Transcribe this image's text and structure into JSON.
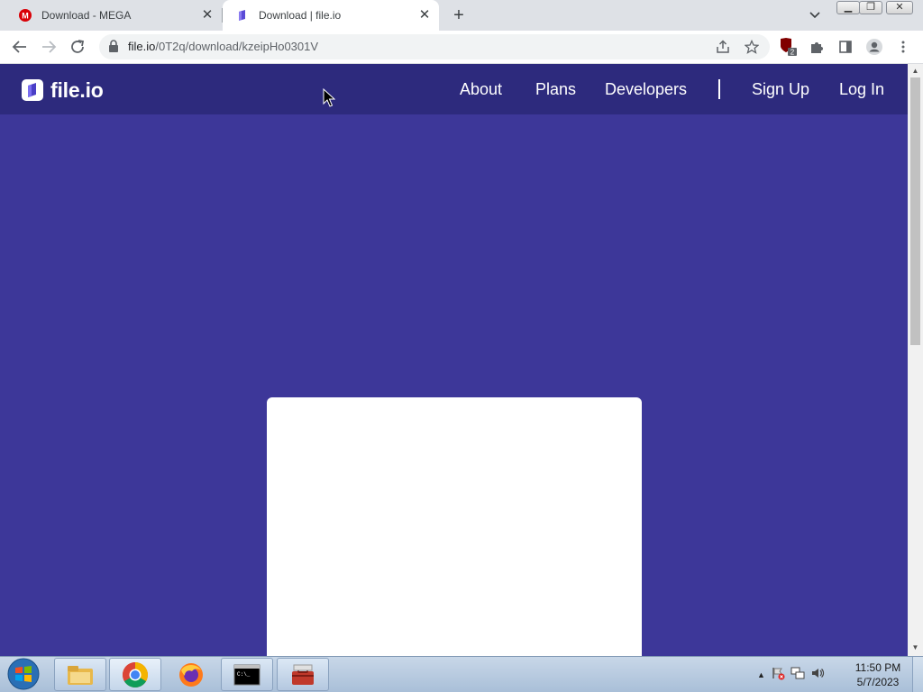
{
  "browser": {
    "tabs": [
      {
        "title": "Download - MEGA",
        "icon": "mega-icon",
        "active": false
      },
      {
        "title": "Download | file.io",
        "icon": "fileio-icon",
        "active": true
      }
    ],
    "url": {
      "host": "file.io",
      "path": "/0T2q/download/kzeipHo0301V"
    },
    "extension_badge": "2"
  },
  "site": {
    "logo_text": "file.io",
    "nav": {
      "about": "About",
      "plans": "Plans",
      "developers": "Developers",
      "sign_up": "Sign Up",
      "log_in": "Log In"
    }
  },
  "taskbar": {
    "clock_time": "11:50 PM",
    "clock_date": "5/7/2023",
    "apps": [
      "file-explorer-icon",
      "chrome-icon",
      "firefox-icon",
      "cmd-icon",
      "toolbox-icon"
    ]
  },
  "colors": {
    "page_bg": "#3d3799",
    "nav_bg": "#2d2a7d",
    "mega_red": "#d90007"
  }
}
